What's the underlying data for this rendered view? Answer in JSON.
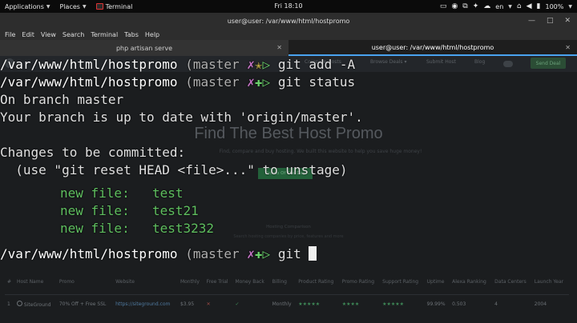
{
  "topbar": {
    "applications": "Applications",
    "places": "Places",
    "active_app": "Terminal",
    "clock": "Fri 18:10",
    "keyboard_layout": "en",
    "battery": "100%"
  },
  "window": {
    "title": "user@user: /var/www/html/hostpromo"
  },
  "menubar": {
    "items": [
      "File",
      "Edit",
      "View",
      "Search",
      "Terminal",
      "Tabs",
      "Help"
    ]
  },
  "tabs": [
    {
      "label": "php artisan serve"
    },
    {
      "label": "user@user: /var/www/html/hostpromo"
    }
  ],
  "background_page": {
    "nav": {
      "links": [
        "Compare Hosts",
        "Browse Deals ▾",
        "Submit Host",
        "Blog"
      ],
      "cta": "Send Deal"
    },
    "hero": {
      "title": "Find The Best Host Promo",
      "subtitle": "Find, compare and buy hosting. We built this website to help you save huge money!",
      "button": "Promo Of The Day"
    },
    "section": {
      "title": "Hosting Comparison",
      "subtitle": "Search hosting companies by price, features and more"
    },
    "table": {
      "headers": [
        "#",
        "Host Name",
        "Promo",
        "Website",
        "Monthly",
        "Free Trial",
        "Money Back",
        "Billing",
        "Product Rating",
        "Promo Rating",
        "Support Rating",
        "Uptime",
        "Alexa Ranking",
        "Data Centers",
        "Launch Year"
      ],
      "rows": [
        [
          "1",
          "SiteGround",
          "70% Off + Free SSL",
          "https://siteground.com",
          "$3.95",
          "✕",
          "✓",
          "Monthly",
          "★★★★★",
          "★★★★",
          "★★★★★",
          "99.99%",
          "0.503",
          "4",
          "2004"
        ]
      ]
    }
  },
  "terminal": {
    "lines": [
      {
        "path": "/var/www/html/hostpromo",
        "branch": "(master ",
        "x": "✗",
        "status": "✭",
        "status_type": "star",
        "arrow": "▷",
        "cmd": "git add -A"
      },
      {
        "path": "/var/www/html/hostpromo",
        "branch": "(master ",
        "x": "✗",
        "status": "✚",
        "status_type": "plus",
        "arrow": "▷",
        "cmd": "git status"
      }
    ],
    "output": {
      "on_branch": "On branch master",
      "up_to_date": "Your branch is up to date with 'origin/master'.",
      "changes_header": "Changes to be committed:",
      "hint": "  (use \"git reset HEAD <file>...\" to unstage)",
      "new_file_label": "new file:",
      "files": [
        "test",
        "test21",
        "test3232"
      ]
    },
    "prompt": {
      "path": "/var/www/html/hostpromo",
      "branch": "(master ",
      "x": "✗",
      "status": "✚",
      "arrow": "▷",
      "cmd": "git "
    }
  }
}
